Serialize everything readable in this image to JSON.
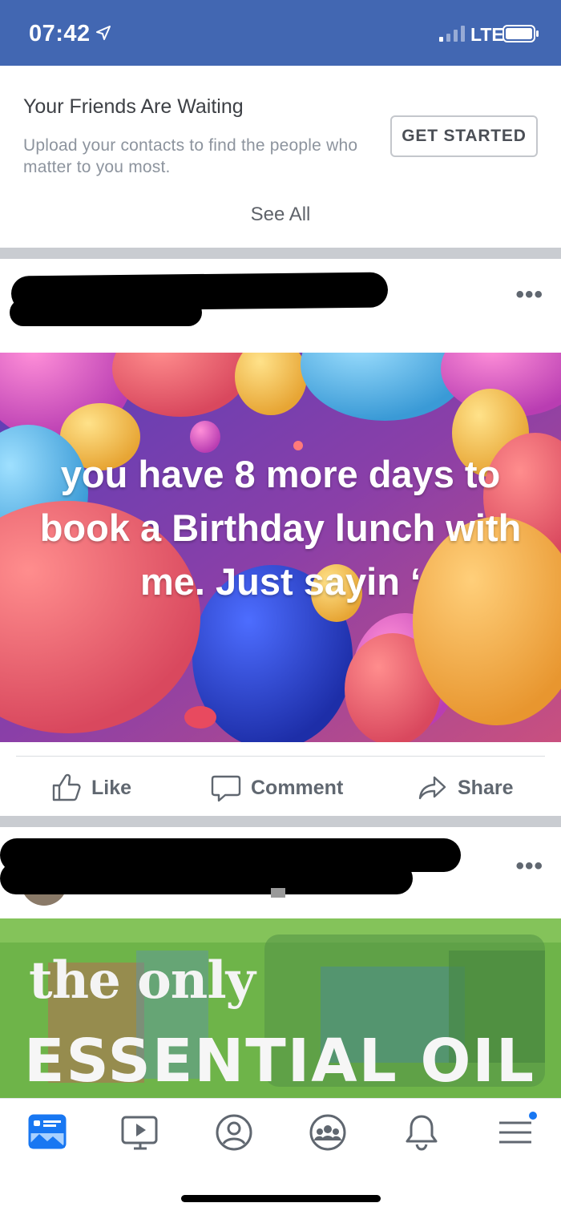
{
  "status_bar": {
    "time": "07:42",
    "network": "LTE",
    "background_color": "#4267b2"
  },
  "friends_card": {
    "title": "Your Friends Are Waiting",
    "subtitle": "Upload your contacts to find the people who matter to you most.",
    "button_label": "GET STARTED",
    "see_all_label": "See All"
  },
  "post1": {
    "more_icon": "more-horizontal-icon",
    "image_text": "you have 8 more days to book a Birthday lunch with me. Just sayin ‘"
  },
  "actions": {
    "like_label": "Like",
    "comment_label": "Comment",
    "share_label": "Share"
  },
  "post2": {
    "image_text_line1": "the only",
    "image_text_line2": "ESSENTIAL OIL"
  },
  "tab_bar": {
    "items": [
      "news-feed-icon",
      "watch-icon",
      "profile-icon",
      "groups-icon",
      "notifications-icon",
      "menu-icon"
    ],
    "active": "news-feed-icon",
    "accent_color": "#1877f2"
  }
}
